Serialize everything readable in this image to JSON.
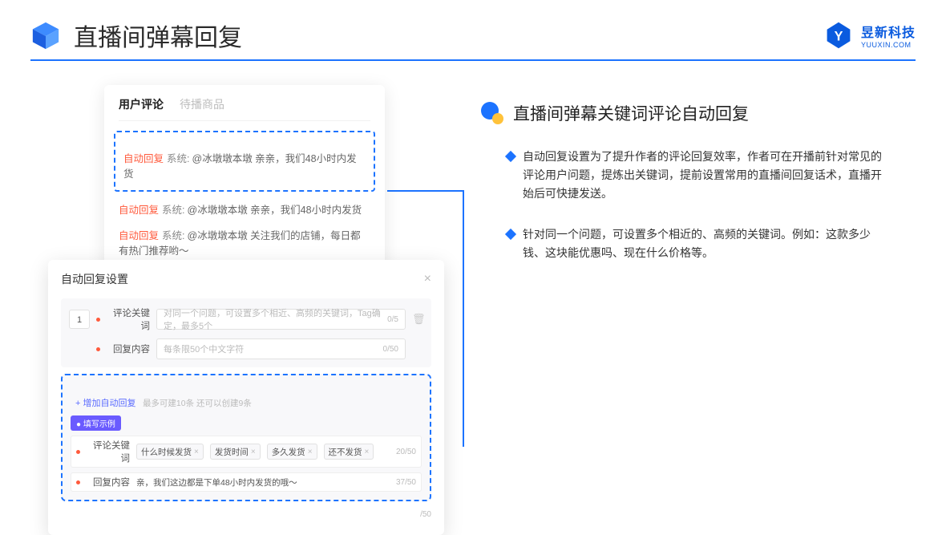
{
  "header": {
    "title": "直播间弹幕回复",
    "brand_cn": "昱新科技",
    "brand_en": "YUUXIN.COM"
  },
  "comments_panel": {
    "tabs": {
      "active": "用户评论",
      "inactive": "待播商品"
    },
    "highlighted": {
      "tag": "自动回复",
      "sys": "系统:",
      "text": "@冰墩墩本墩 亲亲，我们48小时内发货"
    },
    "item2": {
      "tag": "自动回复",
      "sys": "系统:",
      "text": "@冰墩墩本墩 亲亲，我们48小时内发货"
    },
    "item3": {
      "tag": "自动回复",
      "sys": "系统:",
      "text": "@冰墩墩本墩 关注我们的店铺，每日都有热门推荐哟～"
    }
  },
  "settings_panel": {
    "title": "自动回复设置",
    "num": "1",
    "label_keyword": "评论关键词",
    "placeholder_keyword": "对同一个问题，可设置多个相近、高频的关键词，Tag确定，最多5个",
    "count_keyword": "0/5",
    "label_content": "回复内容",
    "placeholder_content": "每条限50个中文字符",
    "count_content": "0/50",
    "add_link": "+ 增加自动回复",
    "add_hint": "最多可建10条 还可以创建9条",
    "example_pill": "● 填写示例",
    "ex_label_keyword": "评论关键词",
    "ex_tags": [
      "什么时候发货",
      "发货时间",
      "多久发货",
      "还不发货"
    ],
    "ex_count_keyword": "20/50",
    "ex_label_content": "回复内容",
    "ex_content": "亲，我们这边都是下单48小时内发货的哦～",
    "ex_count_content": "37/50",
    "trail_count": "/50"
  },
  "right": {
    "title": "直播间弹幕关键词评论自动回复",
    "bullet1": "自动回复设置为了提升作者的评论回复效率，作者可在开播前针对常见的评论用户问题，提炼出关键词，提前设置常用的直播间回复话术，直播开始后可快捷发送。",
    "bullet2": "针对同一个问题，可设置多个相近的、高频的关键词。例如：这款多少钱、这块能优惠吗、现在什么价格等。"
  }
}
